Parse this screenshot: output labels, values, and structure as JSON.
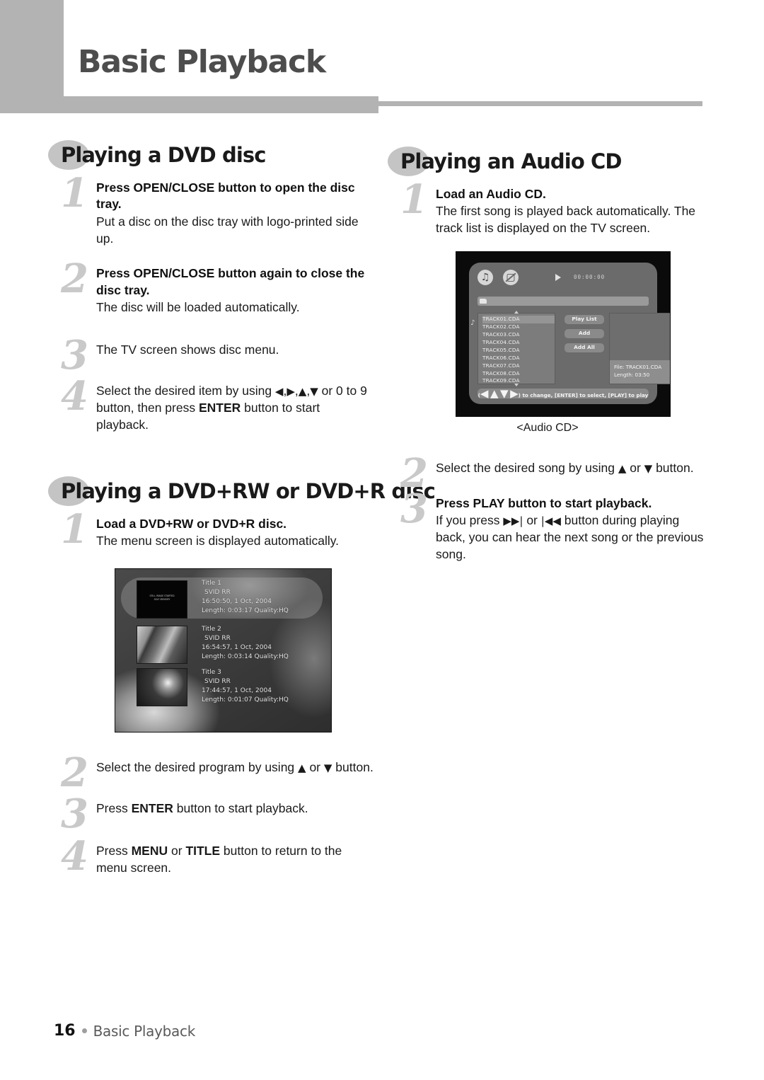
{
  "header": {
    "title": "Basic Playback"
  },
  "left_column": {
    "section1": {
      "heading": "Playing a DVD disc",
      "steps": [
        {
          "num": "1",
          "head": "Press OPEN/CLOSE button to open the disc tray.",
          "body": "Put a disc on the disc tray with logo-printed side up."
        },
        {
          "num": "2",
          "head": "Press OPEN/CLOSE button again to close the disc tray.",
          "body": "The disc will be loaded automatically."
        },
        {
          "num": "3",
          "head": "",
          "body": "The TV screen shows disc menu."
        },
        {
          "num": "4",
          "head": "",
          "body": "Select the desired item by using ◀,▶,▲,▼ or 0 to 9 button, then press ENTER button to start playback."
        }
      ]
    },
    "section2": {
      "heading": "Playing a DVD+RW or DVD+R disc",
      "steps": [
        {
          "num": "1",
          "head": "Load a DVD+RW or DVD+R disc.",
          "body": "The menu screen is displayed automatically."
        },
        {
          "num": "2",
          "head": "",
          "body": "Select the desired program by using ▲ or ▼ button."
        },
        {
          "num": "3",
          "head": "",
          "body": "Press ENTER button to start playback."
        },
        {
          "num": "4",
          "head": "",
          "body": "Press MENU or TITLE button to return to the menu screen."
        }
      ],
      "figure": {
        "titles": [
          {
            "name": "Title 1",
            "format": "SVID RR",
            "timestamp": "16:50:50, 1 Oct, 2004",
            "length": "Length:  0:03:17 Quality:HQ",
            "thumb_text": "STILL IMAGE STARTED\nSELF MEMORY"
          },
          {
            "name": "Title 2",
            "format": "SVID RR",
            "timestamp": "16:54:57, 1 Oct, 2004",
            "length": "Length:  0:03:14 Quality:HQ",
            "thumb_text": ""
          },
          {
            "name": "Title 3",
            "format": "SVID RR",
            "timestamp": "17:44:57, 1 Oct, 2004",
            "length": "Length:  0:01:07 Quality:HQ",
            "thumb_text": ""
          }
        ]
      }
    }
  },
  "right_column": {
    "section1": {
      "heading": "Playing an Audio CD",
      "steps": [
        {
          "num": "1",
          "head": "Load an Audio CD.",
          "body": "The first song is played back automatically. The track list is displayed on the TV screen."
        },
        {
          "num": "2",
          "head": "",
          "body": "Select the desired song by using ▲ or ▼ button."
        },
        {
          "num": "3",
          "head": "Press PLAY button to start playback.",
          "body": "If you press ▶▶| or |◀◀ button during playing back, you can hear the next song or the previous song."
        }
      ],
      "figure": {
        "caption": "<Audio CD>",
        "time_display": "00:00:00",
        "tracks": [
          "TRACK01.CDA",
          "TRACK02.CDA",
          "TRACK03.CDA",
          "TRACK04.CDA",
          "TRACK05.CDA",
          "TRACK06.CDA",
          "TRACK07.CDA",
          "TRACK08.CDA",
          "TRACK09.CDA"
        ],
        "buttons": [
          "Play List",
          "Add",
          "Add All"
        ],
        "file_label": "File: TRACK01.CDA",
        "length_label": "Length: 03:50",
        "status_bar": "(◀ ▲ ▼ ▶) to change, [ENTER] to select, [PLAY] to play"
      }
    }
  },
  "footer": {
    "page": "16",
    "text": "Basic Playback"
  }
}
